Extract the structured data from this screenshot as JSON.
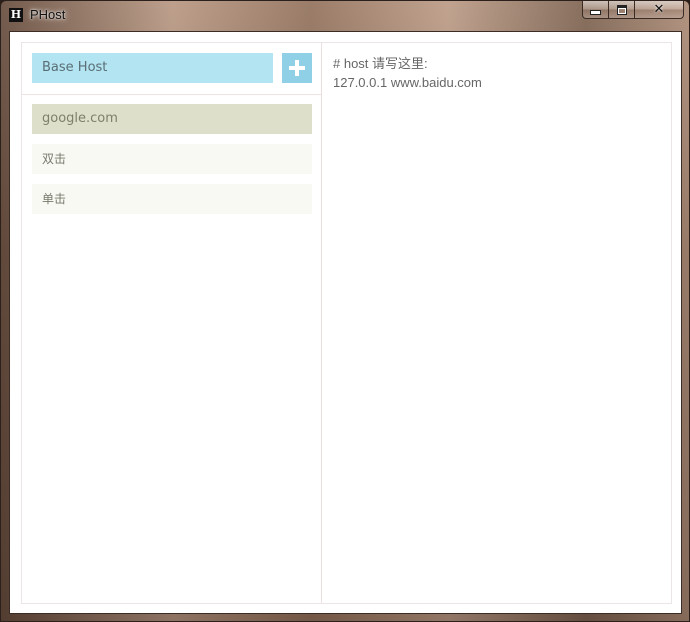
{
  "window": {
    "title": "PHost",
    "icon_letter": "H",
    "controls": {
      "minimize_icon": "minimize-icon",
      "maximize_icon": "maximize-icon",
      "close_icon": "close-icon"
    }
  },
  "sidebar": {
    "base_host_label": "Base Host",
    "add_icon": "plus-icon",
    "items": [
      {
        "label": "google.com",
        "active": true
      },
      {
        "label": "双击",
        "active": false
      },
      {
        "label": "单击",
        "active": false
      }
    ]
  },
  "editor": {
    "lines": [
      "# host 请写这里:",
      "127.0.0.1 www.baidu.com"
    ]
  },
  "colors": {
    "base_host_bg": "#b3e4f1",
    "add_button_bg": "#8fd0e6",
    "active_item_bg": "#dedfcb",
    "item_bg": "#f8f9f3"
  }
}
